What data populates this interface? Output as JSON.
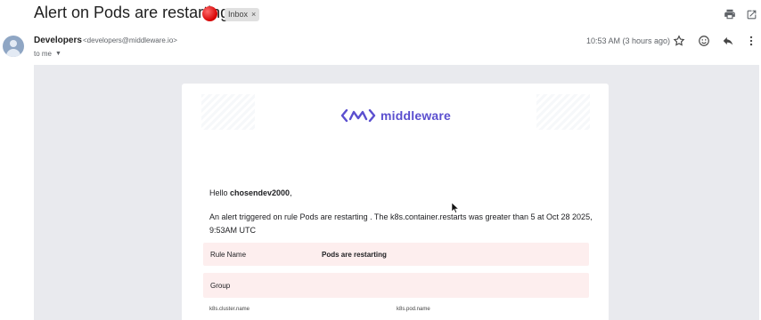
{
  "subject": {
    "title": "Alert on Pods are restarting",
    "label": "Inbox",
    "label_close": "×",
    "icons": [
      "red-circle-emoji",
      "print-icon",
      "open-in-new-window-icon"
    ]
  },
  "sender": {
    "name": "Developers",
    "email": "<developers@middleware.io>",
    "recipient": "to me",
    "timestamp": "10:53 AM (3 hours ago)",
    "action_icons": [
      "star-icon",
      "emoji-reaction-icon",
      "reply-icon",
      "more-vert-icon"
    ]
  },
  "email": {
    "brand": "middleware",
    "greeting_prefix": "Hello ",
    "greeting_user": "chosendev2000",
    "greeting_suffix": ",",
    "alert_text": "An alert triggered on rule Pods are restarting . The k8s.container.restarts was greater than 5 at Oct 28 2025, 9:53AM UTC",
    "rule_name_label": "Rule Name",
    "rule_name_value": "Pods are restarting",
    "group_label": "Group",
    "group_keys": [
      "k8s.cluster.name",
      "k8s.pod.name"
    ],
    "brand_color": "#5b4fcf",
    "row_bg_color": "#fdeeee"
  }
}
